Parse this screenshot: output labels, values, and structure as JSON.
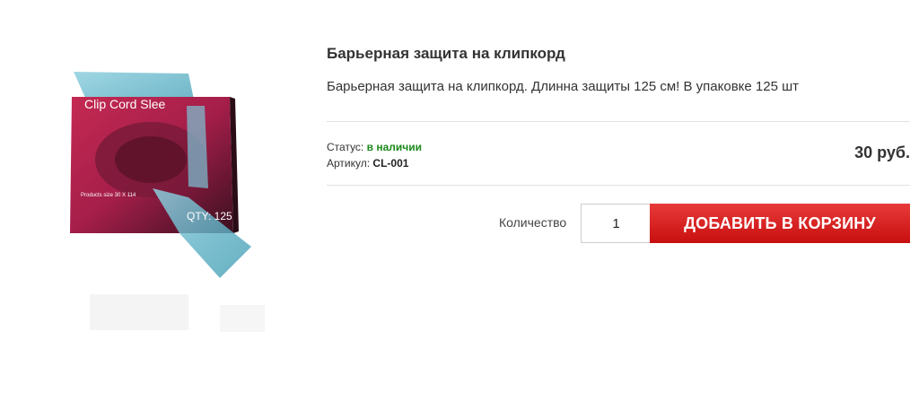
{
  "product": {
    "title": "Барьерная защита на клипкорд",
    "description": "Барьерная защита на клипкорд. Длинна защиты 125 см! В упаковке 125 шт",
    "image": {
      "box_title": "Clip Cord Slee",
      "box_size_text": "Products size 30 X 114",
      "box_qty_text": "QTY: 125"
    },
    "status_label": "Статус:",
    "status_value": "в наличии",
    "sku_label": "Артикул:",
    "sku_value": "CL-001",
    "price": "30 руб."
  },
  "cart": {
    "quantity_label": "Количество",
    "quantity_value": "1",
    "add_button_label": "ДОБАВИТЬ В КОРЗИНУ"
  },
  "colors": {
    "status_in_stock": "#1b8a1b",
    "button_top": "#e83a3a",
    "button_bottom": "#c80f0f",
    "divider": "#e2e2e2"
  }
}
